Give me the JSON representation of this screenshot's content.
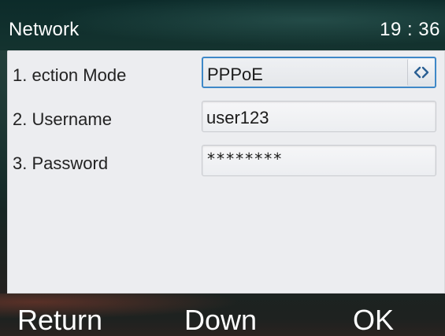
{
  "header": {
    "title": "Network",
    "time": "19 : 36"
  },
  "form": {
    "rows": [
      {
        "label": "1. ection Mode",
        "value": "PPPoE",
        "control": "switch"
      },
      {
        "label": "2. Username",
        "value": "user123",
        "control": "text"
      },
      {
        "label": "3. Password",
        "value": "********",
        "control": "password"
      }
    ],
    "switch_icon": "left-right-arrows-icon"
  },
  "softkeys": {
    "return_label": "Return",
    "down_label": "Down",
    "ok_label": "OK"
  },
  "colors": {
    "focus_border": "#3e88c8",
    "panel_bg": "#ecedf0",
    "header_bg": "#0f2f2d",
    "text_light": "#ffffff"
  }
}
